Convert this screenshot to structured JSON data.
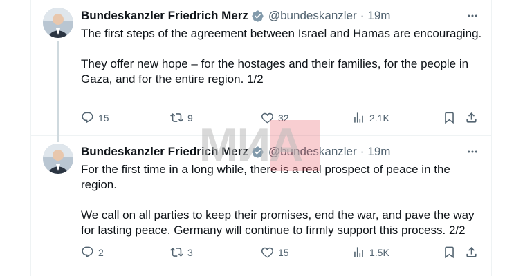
{
  "tweets": [
    {
      "author_name": "Bundeskanzler Friedrich Merz",
      "handle": "@bundeskanzler",
      "separator": "·",
      "time": "19m",
      "paragraphs": [
        "The first steps of the agreement between Israel and Hamas are encouraging.",
        "They offer new hope – for the hostages and their families, for the people in Gaza, and for the entire region. 1/2"
      ],
      "replies": "15",
      "reposts": "9",
      "likes": "32",
      "views": "2.1K"
    },
    {
      "author_name": "Bundeskanzler Friedrich Merz",
      "handle": "@bundeskanzler",
      "separator": "·",
      "time": "19m",
      "paragraphs": [
        "For the first time in a long while, there is a real prospect of peace in the region.",
        "We call on all parties to keep their promises, end the war, and pave the way for lasting peace. Germany will continue to firmly support this process. 2/2"
      ],
      "replies": "2",
      "reposts": "3",
      "likes": "15",
      "views": "1.5K"
    }
  ],
  "watermark": {
    "text": "МИА"
  },
  "icons": {
    "verified": "verified-badge-icon",
    "more": "more-dots-icon",
    "reply": "reply-icon",
    "repost": "repost-icon",
    "like": "heart-icon",
    "views": "views-icon",
    "bookmark": "bookmark-icon",
    "share": "share-icon"
  },
  "colors": {
    "text": "#0f1419",
    "secondary": "#536471",
    "verified": "#829aab"
  }
}
